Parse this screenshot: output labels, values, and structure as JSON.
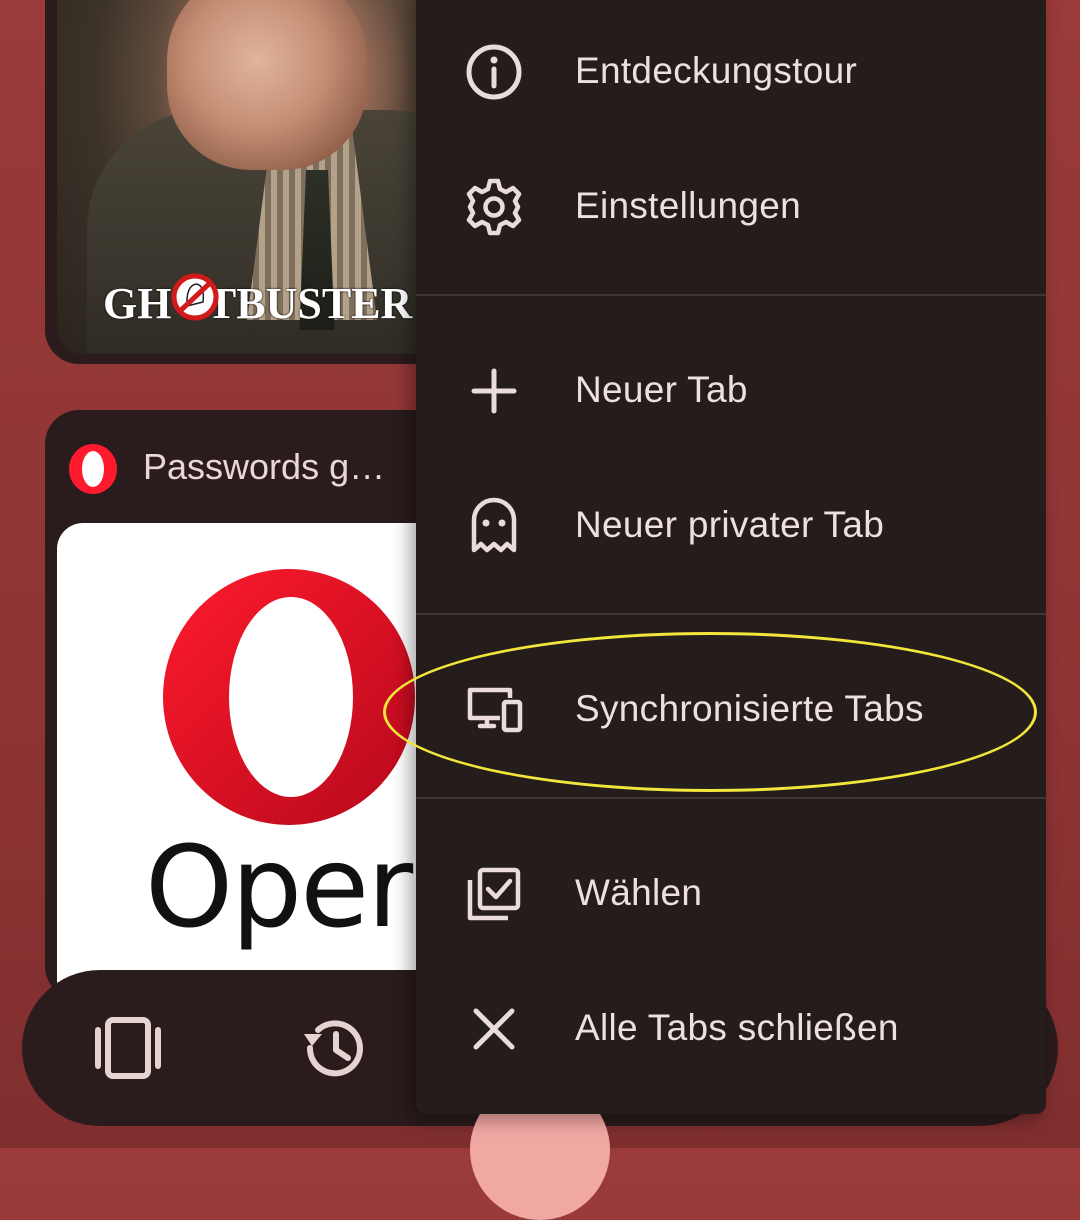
{
  "tabs": [
    {
      "thumbnail_text": "GH  STBUSTER"
    },
    {
      "title": "Passwords g…",
      "thumbnail_text": "Opera"
    }
  ],
  "menu": {
    "items": [
      {
        "label": "Entdeckungstour",
        "icon": "info-icon"
      },
      {
        "label": "Einstellungen",
        "icon": "gear-icon"
      },
      {
        "label": "Neuer Tab",
        "icon": "plus-icon"
      },
      {
        "label": "Neuer privater Tab",
        "icon": "ghost-icon"
      },
      {
        "label": "Synchronisierte Tabs",
        "icon": "devices-icon",
        "highlighted": true
      },
      {
        "label": "Wählen",
        "icon": "select-check-icon"
      },
      {
        "label": "Alle Tabs schließen",
        "icon": "close-icon"
      }
    ]
  },
  "bottom_bar": {
    "buttons": [
      {
        "icon": "tabs-icon"
      },
      {
        "icon": "history-icon"
      }
    ]
  },
  "colors": {
    "background": "#963838",
    "menu_bg": "#251c1c",
    "highlight": "#f2e63a",
    "fab": "#f1a8a3",
    "opera_red": "#ff1b2d"
  }
}
